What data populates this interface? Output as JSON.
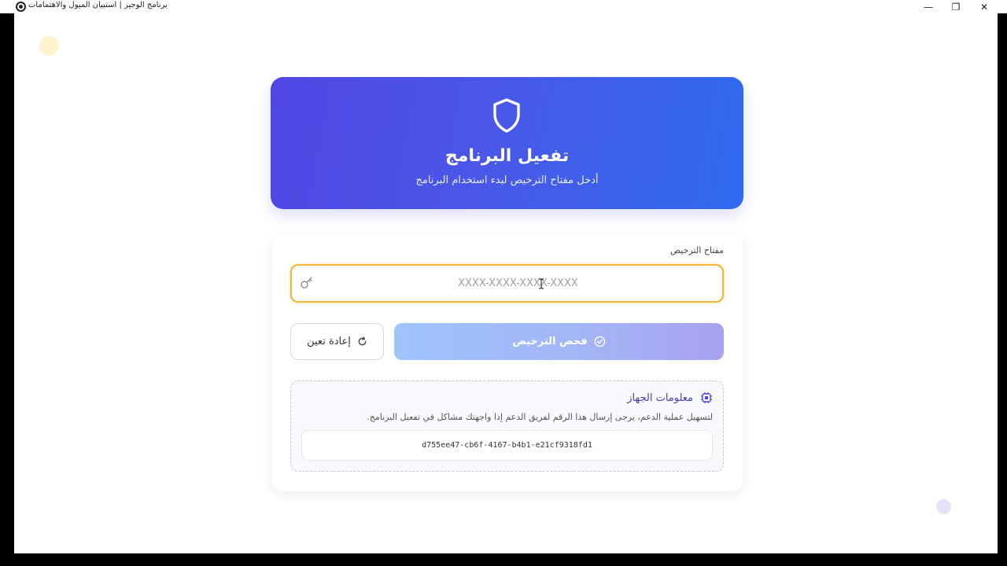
{
  "window": {
    "title": "برنامج الوجيز | استبيان الميول والاهتمامات",
    "minimize_glyph": "—",
    "restore_glyph": "❐",
    "close_glyph": "✕"
  },
  "hero": {
    "icon": "shield-icon",
    "title": "تفعيل البرنامج",
    "subtitle": "أدخل مفتاح الترخيص لبدء استخدام البرنامج"
  },
  "license": {
    "label": "مفتاح الترخيص",
    "placeholder": "XXXX-XXXX-XXXX-XXXX",
    "value": "",
    "icon": "key-icon"
  },
  "buttons": {
    "check_label": "فحص الترخيص",
    "check_icon": "check-circle-icon",
    "reset_label": "إعادة تعين",
    "reset_icon": "refresh-icon"
  },
  "device": {
    "title": "معلومات الجهاز",
    "icon": "chip-icon",
    "description": "لتسهيل عملية الدعم، يرجى إرسال هذا الرقم لفريق الدعم إذا واجهتك مشاكل في تفعيل البرنامج.",
    "id": "d755ee47-cb6f-4167-b4b1-e21cf9318fd1"
  },
  "colors": {
    "hero_gradient_start": "#5146e4",
    "hero_gradient_end": "#2f6bf0",
    "input_focus_border": "#f2b53a",
    "check_button": "#a3b6f6",
    "device_title": "#4a3fb3"
  }
}
